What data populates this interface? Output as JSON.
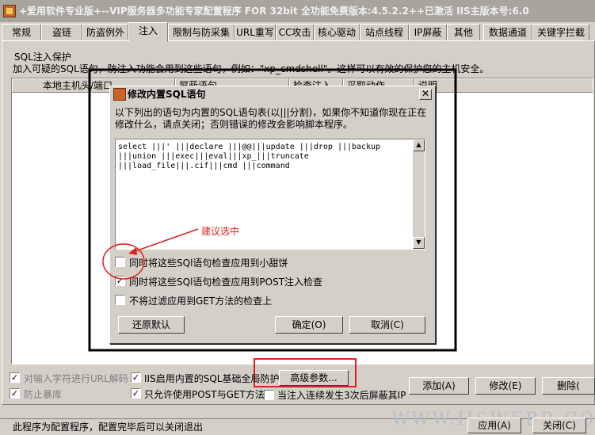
{
  "window": {
    "title": "+爱用软件专业版+--VIP服务器多功能专家配置程序 FOR 32bit 全功能免费版本:4.5.2.2++已激活 IIS主版本号:6.0"
  },
  "tabs": [
    {
      "label": "常规"
    },
    {
      "label": "盗链"
    },
    {
      "label": "防盗例外"
    },
    {
      "label": "注入"
    },
    {
      "label": "限制与防采集"
    },
    {
      "label": "URL重写"
    },
    {
      "label": "CC攻击"
    },
    {
      "label": "核心驱动"
    },
    {
      "label": "站点线程"
    },
    {
      "label": "IP屏蔽"
    },
    {
      "label": "其他"
    },
    {
      "label": "数据通道"
    },
    {
      "label": "关键字拦截"
    }
  ],
  "group": {
    "label": "SQL注入保护",
    "description": "加入可疑的SQL语句，防注入功能会用到这些语句，例如：\"xp_cmdshell\"。这样可以有效的保护您的主机安全。"
  },
  "list": {
    "columns": [
      "本地主机头/端口",
      "屏蔽语句",
      "检查注入",
      "采取动作",
      "说明"
    ]
  },
  "dialog": {
    "title": "修改内置SQL语句",
    "description": "以下列出的语句为内置的SQL语句表(以|||分割)，如果你不知道你现在正在修改什么，请点关闭；否则错误的修改会影响脚本程序。",
    "sql_text": "select |||' |||declare |||@@|||update |||drop |||backup\n|||union |||exec|||eval|||xp_|||truncate\n|||load_file|||.cif|||cmd |||command",
    "checkboxes": [
      {
        "label": "同时将这些SQl语句检查应用到小甜饼",
        "checked": false
      },
      {
        "label": "同时将这些SQl语句检查应用到POST注入检查",
        "checked": true
      },
      {
        "label": "不将过滤应用到GET方法的检查上",
        "checked": false
      }
    ],
    "restore_button": "还原默认",
    "ok_button": "确定(O)",
    "cancel_button": "取消(C)",
    "close_glyph": "✕"
  },
  "annotation": {
    "text": "建议选中",
    "color": "#e02020"
  },
  "bottom": {
    "cb_url_decode": {
      "label": "对输入字符进行URL解码",
      "checked": true
    },
    "cb_prevent_crash": {
      "label": "防止暴库",
      "checked": true
    },
    "cb_iis_sql": {
      "label": "IIS启用内置的SQL基础全局防护",
      "checked": true
    },
    "cb_post_get": {
      "label": "只允许使用POST与GET方法",
      "checked": true
    },
    "cb_block_ip": {
      "label": "当注入连续发生3次后屏蔽其IP",
      "checked": false
    },
    "advanced_button": "高级参数...",
    "add_button": "添加(A)",
    "modify_button": "修改(E)",
    "delete_button": "删除(",
    "apply_button": "应用(A)",
    "close_button": "关闭(C)"
  },
  "status": {
    "text": "此程序为配置程序，配置完毕后可以关闭退出"
  },
  "watermark": {
    "text": "WWW.IISWEBR.COM"
  }
}
